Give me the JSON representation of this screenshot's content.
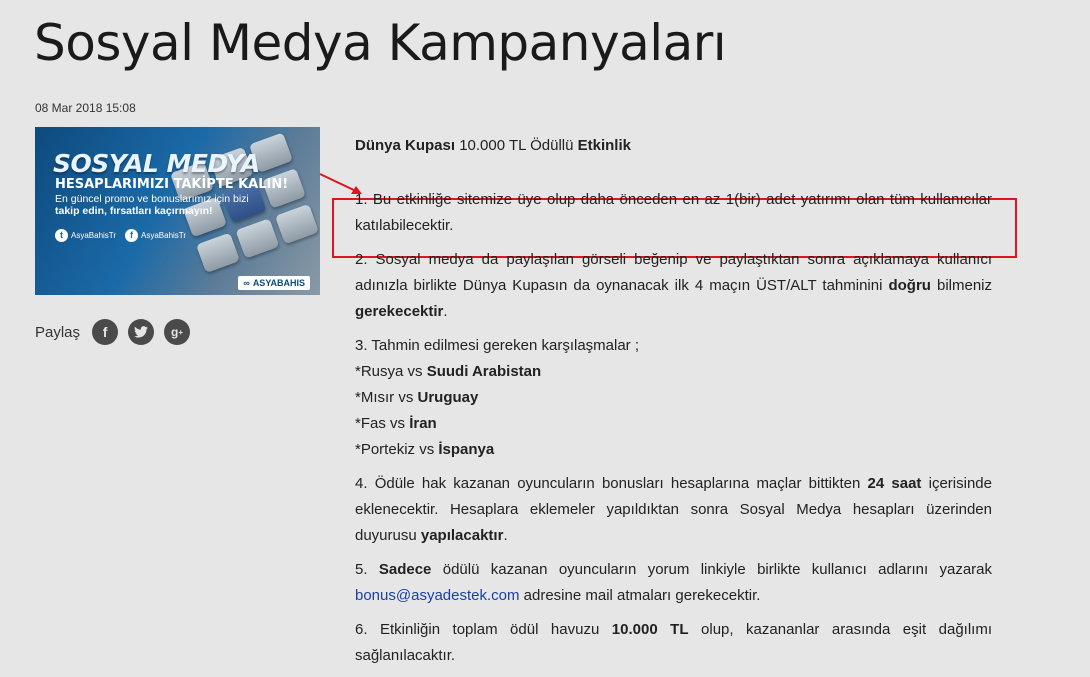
{
  "article": {
    "title": "Sosyal Medya Kampanyaları",
    "date": "08 Mar 2018 15:08"
  },
  "banner": {
    "headline": "SOSYAL MEDYA",
    "subheadline": "HESAPLARIMIZI TAKİPTE KALIN!",
    "line1": "En güncel promo ve bonuslarımız için bizi",
    "line2": "takip edin, fırsatları kaçırmayın!",
    "twitter_handle": "AsyaBahisTr",
    "facebook_handle": "AsyaBahisTr",
    "brand": "ASYABAHIS"
  },
  "share": {
    "label": "Paylaş",
    "icons": [
      "facebook-icon",
      "twitter-icon",
      "google-plus-icon"
    ]
  },
  "content": {
    "lead": {
      "part1": "Dünya Kupası",
      "part2": " 10.000 TL Ödüllü ",
      "part3": "Etkinlik"
    },
    "item1": "1. Bu etkinliğe sitemize üye olup daha önceden en az 1(bir) adet yatırımı olan tüm kullanıcılar katılabilecektir.",
    "item2": {
      "text": "2. Sosyal medya da paylaşılan görseli beğenip ve paylaştıktan sonra açıklamaya kullanıcı adınızla birlikte Dünya Kupasın da oynanacak ilk 4 maçın ÜST/ALT tahminini ",
      "bold1": "doğru",
      "mid": " bilmeniz ",
      "bold2": "gerekecektir",
      "end": "."
    },
    "item3": {
      "intro": "3. Tahmin edilmesi gereken karşılaşmalar ;",
      "matches": [
        {
          "home": "*Rusya vs ",
          "away": "Suudi Arabistan"
        },
        {
          "home": "*Mısır vs ",
          "away": "Uruguay"
        },
        {
          "home": "*Fas vs ",
          "away": "İran"
        },
        {
          "home": "*Portekiz vs ",
          "away": "İspanya"
        }
      ]
    },
    "item4": {
      "text": "4. Ödüle hak kazanan oyuncuların bonusları hesaplarına maçlar bittikten ",
      "bold1": "24 saat",
      "mid": " içerisinde eklenecektir.  Hesaplara eklemeler yapıldıktan sonra Sosyal Medya hesapları üzerinden duyurusu ",
      "bold2": "yapılacaktır",
      "end": "."
    },
    "item5": {
      "prefix": "5. ",
      "bold": "Sadece",
      "text": " ödülü kazanan oyuncuların yorum linkiyle birlikte kullanıcı adlarını yazarak ",
      "link": "bonus@asyadestek.com",
      "end": " adresine mail atmaları gerekecektir."
    },
    "item6": {
      "text": "6. Etkinliğin toplam ödül havuzu ",
      "bold": "10.000 TL",
      "end": " olup, kazananlar arasında eşit dağılımı sağlanılacaktır."
    }
  },
  "annotation": {
    "color": "#e0141e"
  }
}
